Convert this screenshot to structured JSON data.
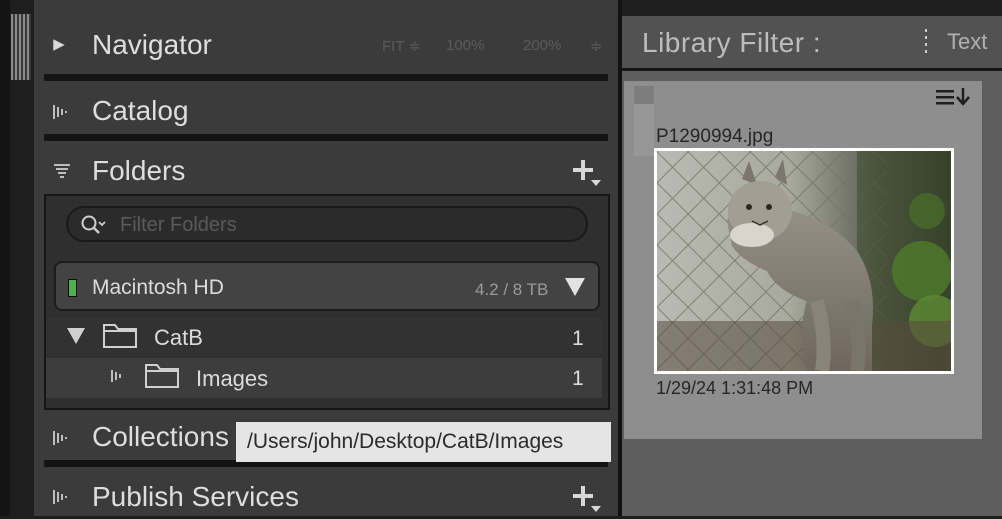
{
  "navigator": {
    "title": "Navigator",
    "zoom_fit": "FIT ≑",
    "zoom_100": "100%",
    "zoom_200": "200%",
    "zoom_more": "≑"
  },
  "catalog": {
    "title": "Catalog"
  },
  "folders": {
    "title": "Folders",
    "search": {
      "placeholder": "Filter Folders"
    },
    "volume": {
      "name": "Macintosh HD",
      "size": "4.2 / 8 TB",
      "indicator_color": "#4db34b"
    },
    "items": [
      {
        "name": "CatB",
        "count": "1",
        "expanded": true,
        "icon": "folder-icon"
      },
      {
        "name": "Images",
        "count": "1",
        "expanded": false,
        "icon": "folder-icon"
      }
    ]
  },
  "collections": {
    "title": "Collections"
  },
  "publish_services": {
    "title": "Publish Services"
  },
  "tooltip": {
    "text": "/Users/john/Desktop/CatB/Images"
  },
  "library_filter": {
    "title": "Library Filter :",
    "text_tab": "Text"
  },
  "grid": {
    "photo": {
      "filename": "P1290994.jpg",
      "capture_date": "1/29/24 1:31:48 PM",
      "subject_icon": "lynx-photo"
    }
  }
}
